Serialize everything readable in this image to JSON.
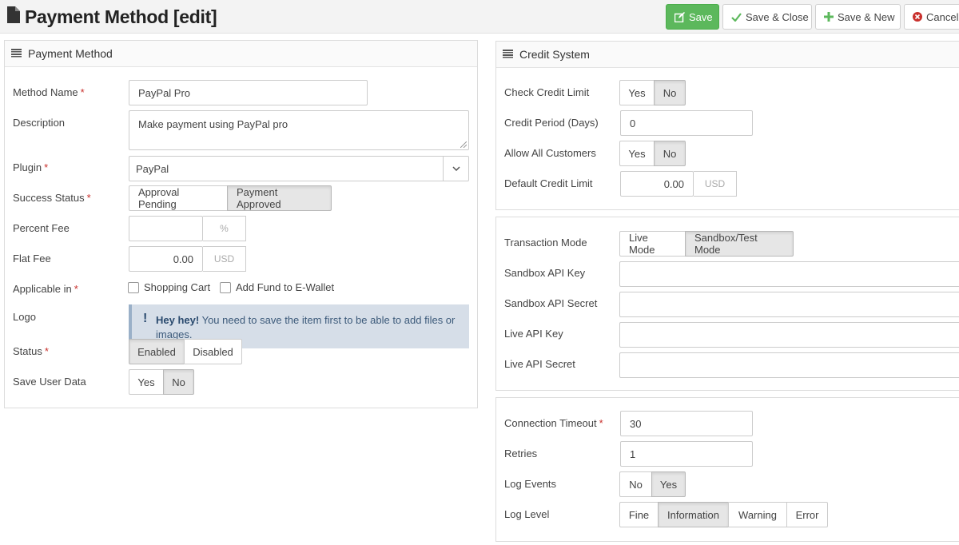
{
  "header": {
    "title": "Payment Method [edit]",
    "buttons": {
      "save": "Save",
      "save_close": "Save & Close",
      "save_new": "Save & New",
      "cancel": "Cancel"
    }
  },
  "left_panel": {
    "title": "Payment Method",
    "method_name": {
      "label": "Method Name",
      "value": "PayPal Pro"
    },
    "description": {
      "label": "Description",
      "value": "Make payment using PayPal pro"
    },
    "plugin": {
      "label": "Plugin",
      "value": "PayPal"
    },
    "success_status": {
      "label": "Success Status",
      "options": [
        "Approval Pending",
        "Payment Approved"
      ],
      "selected": "Payment Approved"
    },
    "percent_fee": {
      "label": "Percent Fee",
      "value": "",
      "unit": "%"
    },
    "flat_fee": {
      "label": "Flat Fee",
      "value": "0.00",
      "unit": "USD"
    },
    "applicable_in": {
      "label": "Applicable in",
      "options": [
        "Shopping Cart",
        "Add Fund to E-Wallet"
      ]
    },
    "logo": {
      "label": "Logo",
      "alert_strong": "Hey hey!",
      "alert_text": "You need to save the item first to be able to add files or images."
    },
    "status": {
      "label": "Status",
      "options": [
        "Enabled",
        "Disabled"
      ],
      "selected": "Enabled"
    },
    "save_user_data": {
      "label": "Save User Data",
      "options": [
        "Yes",
        "No"
      ],
      "selected": "No"
    }
  },
  "credit_panel": {
    "title": "Credit System",
    "check_credit_limit": {
      "label": "Check Credit Limit",
      "options": [
        "Yes",
        "No"
      ],
      "selected": "No"
    },
    "credit_period": {
      "label": "Credit Period (Days)",
      "value": "0"
    },
    "allow_all_customers": {
      "label": "Allow All Customers",
      "options": [
        "Yes",
        "No"
      ],
      "selected": "No"
    },
    "default_credit_limit": {
      "label": "Default Credit Limit",
      "value": "0.00",
      "unit": "USD"
    }
  },
  "api_panel": {
    "transaction_mode": {
      "label": "Transaction Mode",
      "options": [
        "Live Mode",
        "Sandbox/Test Mode"
      ],
      "selected": "Sandbox/Test Mode"
    },
    "sandbox_api_key": {
      "label": "Sandbox API Key",
      "value": ""
    },
    "sandbox_api_secret": {
      "label": "Sandbox API Secret",
      "value": ""
    },
    "live_api_key": {
      "label": "Live API Key",
      "value": ""
    },
    "live_api_secret": {
      "label": "Live API Secret",
      "value": ""
    }
  },
  "connection_panel": {
    "connection_timeout": {
      "label": "Connection Timeout",
      "value": "30"
    },
    "retries": {
      "label": "Retries",
      "value": "1"
    },
    "log_events": {
      "label": "Log Events",
      "options": [
        "No",
        "Yes"
      ],
      "selected": "Yes"
    },
    "log_level": {
      "label": "Log Level",
      "options": [
        "Fine",
        "Information",
        "Warning",
        "Error"
      ],
      "selected": "Information"
    }
  },
  "colors": {
    "save_button": "#5cb85c",
    "required_marker": "#c9302c",
    "alert_bg": "#d6dee8"
  }
}
